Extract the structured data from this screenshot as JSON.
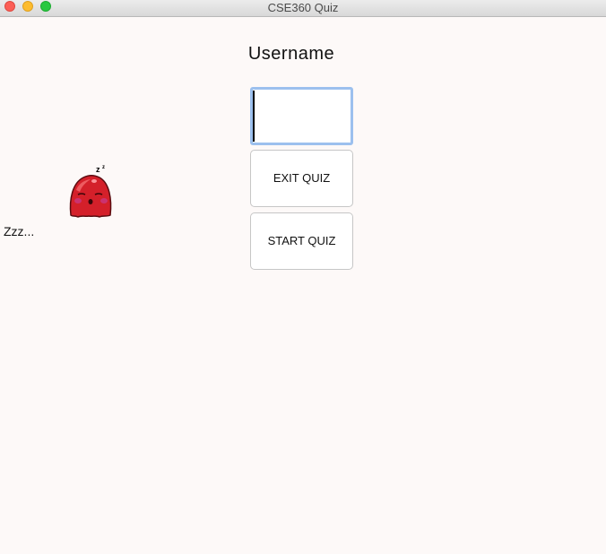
{
  "window": {
    "title": "CSE360 Quiz"
  },
  "login": {
    "username_label": "Username",
    "username_value": "",
    "exit_button_label": "EXIT QUIZ",
    "start_button_label": "START QUIZ"
  },
  "mascot": {
    "icon": "sleeping-blob-mascot-icon",
    "status_text": "Zzz..."
  }
}
